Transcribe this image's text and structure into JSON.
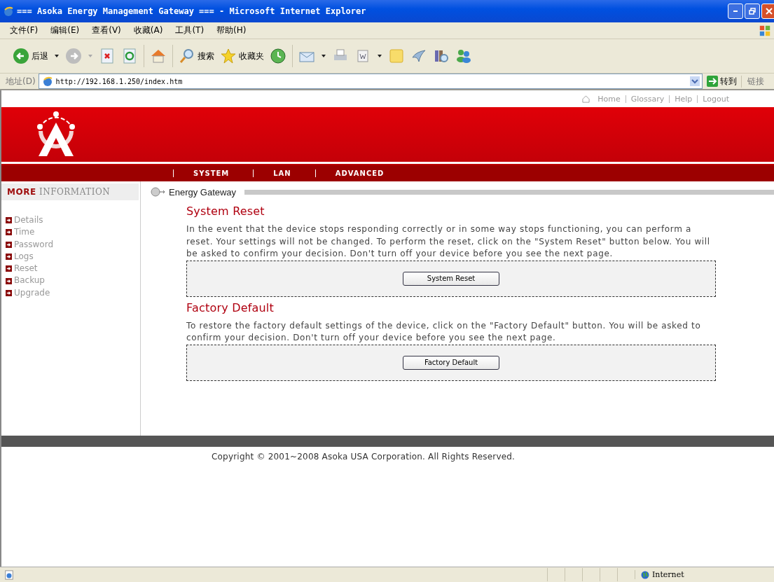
{
  "window": {
    "title": "=== Asoka Energy Management Gateway === - Microsoft Internet Explorer"
  },
  "menu_bar": [
    "文件(F)",
    "编辑(E)",
    "查看(V)",
    "收藏(A)",
    "工具(T)",
    "帮助(H)"
  ],
  "toolbar": [
    {
      "kind": "back",
      "label": "后退",
      "dropdown": true
    },
    {
      "kind": "forward",
      "dropdown": true
    },
    {
      "kind": "stop"
    },
    {
      "kind": "refresh"
    },
    {
      "kind": "home"
    },
    {
      "kind": "search",
      "label": "搜索"
    },
    {
      "kind": "favorites",
      "label": "收藏夹"
    },
    {
      "kind": "history"
    },
    {
      "kind": "mail",
      "dropdown": true
    },
    {
      "kind": "print"
    },
    {
      "kind": "edit",
      "dropdown": true
    },
    {
      "kind": "note"
    },
    {
      "kind": "bird"
    },
    {
      "kind": "research"
    },
    {
      "kind": "messenger"
    }
  ],
  "address_bar": {
    "label": "地址(D)",
    "url": "http://192.168.1.250/index.htm",
    "go": "转到",
    "links": "链接"
  },
  "page": {
    "top_links": [
      "Home",
      "Glossary",
      "Help",
      "Logout"
    ],
    "nav": [
      "SYSTEM",
      "LAN",
      "ADVANCED"
    ],
    "sidebar": {
      "heading_accent": "MORE",
      "heading": "INFORMATION",
      "items": [
        "Details",
        "Time",
        "Password",
        "Logs",
        "Reset",
        "Backup",
        "Upgrade"
      ]
    },
    "breadcrumb": "Energy Gateway",
    "sections": [
      {
        "title": "System Reset",
        "text": "In the event that the device stops responding correctly or in some way stops functioning, you can perform a reset. Your settings will not be changed. To perform the reset, click on the \"System Reset\" button below. You will be asked to confirm your decision. Don't turn off your device before you see the next page.",
        "button": "System Reset"
      },
      {
        "title": "Factory Default",
        "text": "To restore the factory default settings of the device, click on the \"Factory Default\" button. You will be asked to confirm your decision. Don't turn off your device before you see the next page.",
        "button": "Factory Default"
      }
    ],
    "copyright": "Copyright © 2001~2008 Asoka USA Corporation. All Rights Reserved."
  },
  "status_bar": {
    "zone": "Internet"
  }
}
